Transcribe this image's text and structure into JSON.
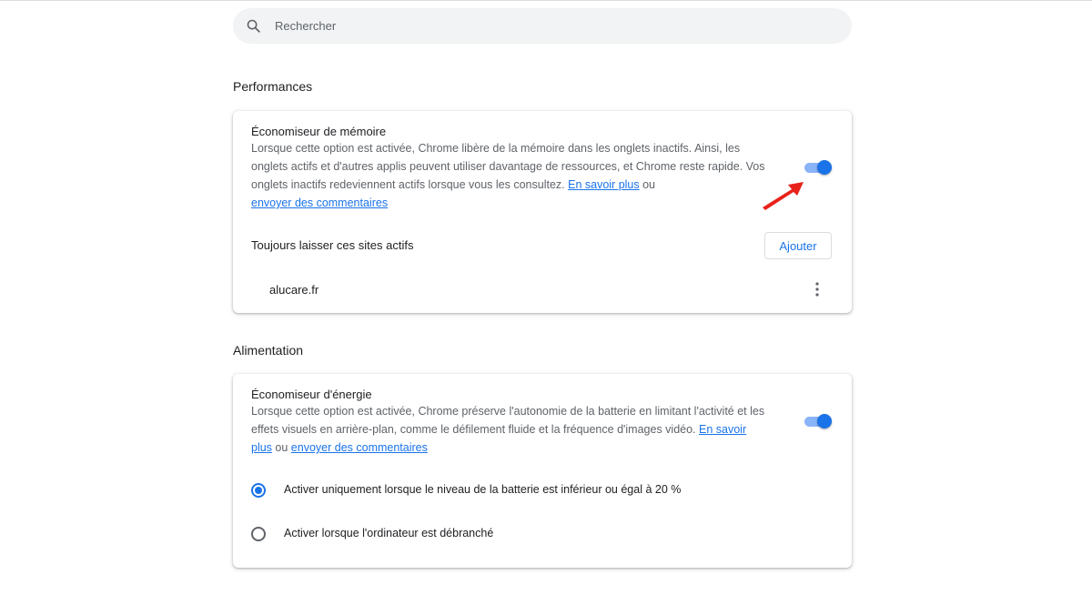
{
  "search": {
    "placeholder": "Rechercher",
    "icon": "search-icon"
  },
  "performance": {
    "section_title": "Performances",
    "memory_saver": {
      "title": "Économiseur de mémoire",
      "description_line1": "Lorsque cette option est activée, Chrome libère de la mémoire dans les onglets inactifs. Ainsi, les",
      "description_line2": "onglets actifs et d'autres applis peuvent utiliser davantage de ressources, et Chrome reste rapide. Vos",
      "description_line3_prefix": "onglets inactifs redeviennent actifs lorsque vous les consultez. ",
      "learn_more": "En savoir plus",
      "or": " ou",
      "feedback": "envoyer des commentaires",
      "enabled": true
    },
    "always_active": {
      "label": "Toujours laisser ces sites actifs",
      "add_label": "Ajouter",
      "sites": [
        "alucare.fr"
      ]
    }
  },
  "power": {
    "section_title": "Alimentation",
    "energy_saver": {
      "title": "Économiseur d'énergie",
      "description_line1": "Lorsque cette option est activée, Chrome préserve l'autonomie de la batterie en limitant l'activité et les",
      "description_line2_prefix": "effets visuels en arrière-plan, comme le défilement fluide et la fréquence d'images vidéo. ",
      "learn_more_part1": "En savoir",
      "learn_more_part2": "plus",
      "or": " ou ",
      "feedback": "envoyer des commentaires",
      "enabled": true
    },
    "options": [
      {
        "label": "Activer uniquement lorsque le niveau de la batterie est inférieur ou égal à 20 %",
        "checked": true
      },
      {
        "label": "Activer lorsque l'ordinateur est débranché",
        "checked": false
      }
    ]
  },
  "colors": {
    "accent": "#1a73e8",
    "toggle_track": "#8ab4f8",
    "annotation_arrow": "#e8221a"
  }
}
